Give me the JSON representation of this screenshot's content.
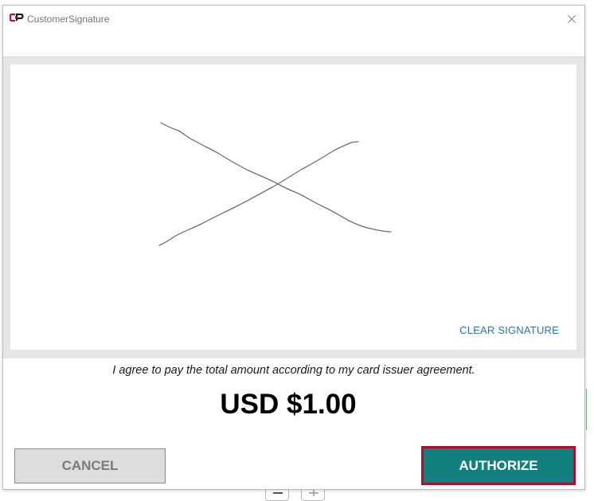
{
  "window": {
    "title": "CustomerSignature",
    "logo_icon": "cp-logo-icon",
    "close_icon": "close-icon"
  },
  "signature_pad": {
    "clear_label": "CLEAR SIGNATURE"
  },
  "agreement_text": "I agree to pay the total amount according to my card issuer agreement.",
  "amount": "USD $1.00",
  "actions": {
    "cancel_label": "CANCEL",
    "authorize_label": "AUTHORIZE"
  },
  "colors": {
    "authorize_bg": "#138080",
    "authorize_border": "#b10e2e",
    "clear_link": "#2e74b5",
    "logo_red": "#c8102e"
  },
  "background_controls": {
    "zoom_out_icon": "minus-icon",
    "zoom_in_icon": "plus-icon"
  }
}
